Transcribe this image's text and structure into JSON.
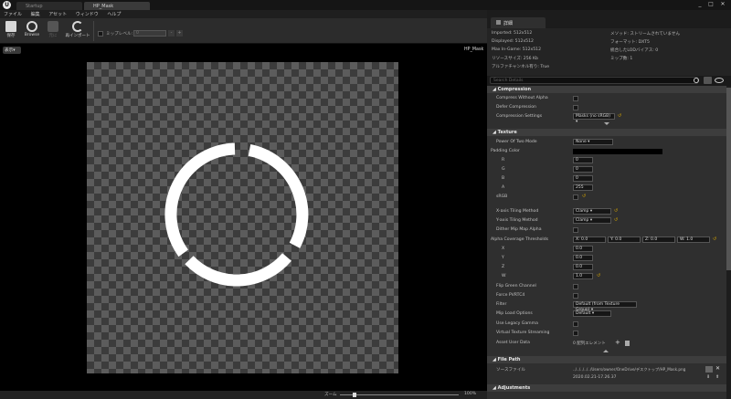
{
  "window": {
    "tabs": [
      {
        "label": "Startup"
      },
      {
        "label": "HP_Mask"
      }
    ],
    "right_tab": "詳細",
    "controls": [
      "_",
      "□",
      "✕"
    ]
  },
  "menubar": {
    "items": [
      "ファイル",
      "編集",
      "アセット",
      "ウィンドウ",
      "ヘルプ"
    ]
  },
  "toolbar": {
    "save": "保存",
    "browse": "Browse",
    "reimport": "再インポート",
    "disabled": "元に",
    "mip_label": "ミップレベル:",
    "mip_value": "0"
  },
  "viewport": {
    "view_button": "表示▾",
    "asset_name": "HP_Mask",
    "zoom_label": "ズーム",
    "zoom_value": "100%"
  },
  "info": {
    "imported": "Imported: 512x512",
    "displayed": "Displayed: 512x512",
    "max_ingame": "Max In-Game: 512x512",
    "resource_size": "リソースサイズ: 256 Kb",
    "alpha": "アルファチャンネル有り: True",
    "method": "メソッド: ストリームされていません",
    "format": "フォーマット: DXT5",
    "lod_bias": "統合したLODバイアス: 0",
    "mip_count": "ミップ数: 1"
  },
  "search": {
    "placeholder": "Search Details"
  },
  "compression": {
    "title": "Compression",
    "compress_without_alpha": "Compress Without Alpha",
    "defer_compression": "Defer Compression",
    "compression_settings": "Compression Settings",
    "compression_settings_value": "Masks (no sRGB) ▾"
  },
  "texture": {
    "title": "Texture",
    "power_of_two": "Power Of Two Mode",
    "power_of_two_value": "None ▾",
    "padding_color": "Padding Color",
    "r": "R",
    "g": "G",
    "b": "B",
    "a": "A",
    "r_val": "0",
    "g_val": "0",
    "b_val": "0",
    "a_val": "255",
    "srgb": "sRGB",
    "x_tiling": "X-axis Tiling Method",
    "x_tiling_value": "Clamp ▾",
    "y_tiling": "Y-axis Tiling Method",
    "y_tiling_value": "Clamp ▾",
    "dither": "Dither Mip Map Alpha",
    "alpha_cov": "Alpha Coverage Thresholds",
    "ac_x": "X: 0.0",
    "ac_y": "Y: 0.0",
    "ac_z": "Z: 0.0",
    "ac_w": "W: 1.0",
    "x": "X",
    "y": "Y",
    "z": "Z",
    "w": "W",
    "x_val": "0.0",
    "y_val": "0.0",
    "z_val": "0.0",
    "w_val": "1.0",
    "flip_green": "Flip Green Channel",
    "force_pvrtc4": "Force PVRTC4",
    "filter": "Filter",
    "filter_value": "Default (from Texture Group) ▾",
    "mip_load": "Mip Load Options",
    "mip_load_value": "Default ▾",
    "legacy_gamma": "Use Legacy Gamma",
    "vt_streaming": "Virtual Texture Streaming",
    "asset_user_data": "Asset User Data",
    "asset_user_data_value": "0 配列エレメント"
  },
  "filepath": {
    "title": "File Path",
    "source_label": "ソースファイル",
    "path": "../../../../../Users/owner/OneDrive/デスクトップ/HP_Mask.png",
    "date": "2020.02.21-17.26.37"
  },
  "adjustments": {
    "title": "Adjustments"
  },
  "colors": {
    "accent": "#d4a300",
    "panel": "#2f2f2f",
    "viewport": "#000000"
  }
}
